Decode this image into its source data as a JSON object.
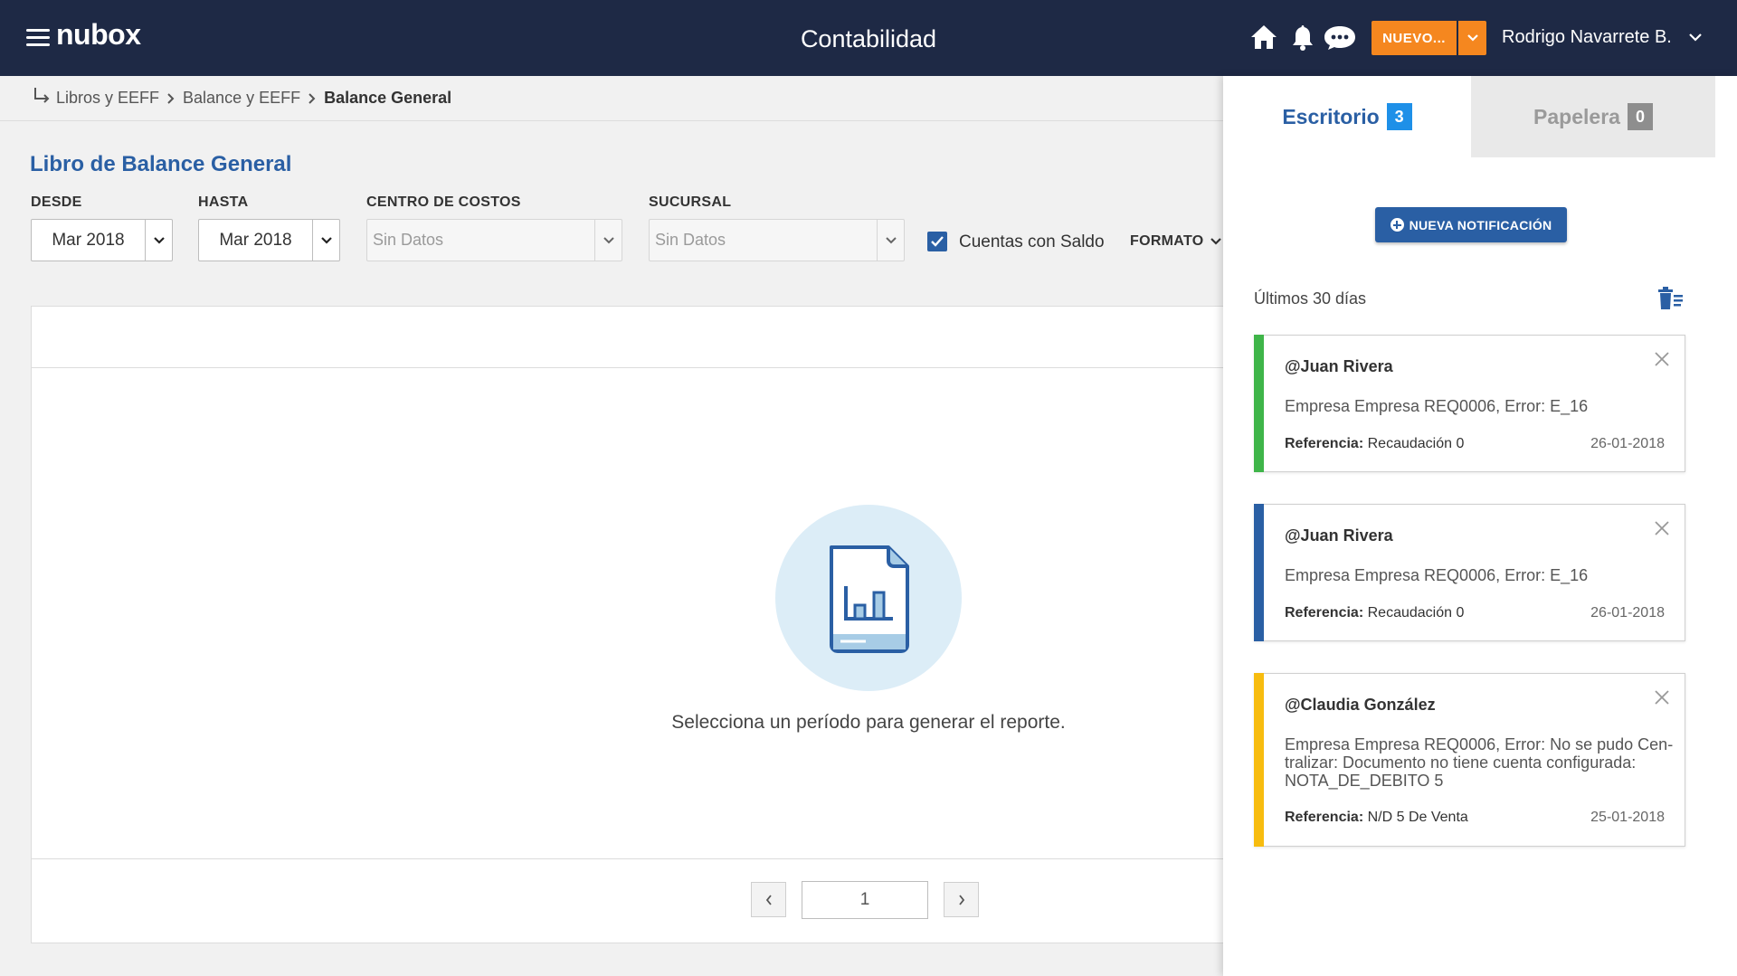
{
  "header": {
    "logo": "nubox",
    "title": "Contabilidad",
    "new_button": "NUEVO...",
    "user_name": "Rodrigo Navarrete B."
  },
  "breadcrumb": [
    "Libros y EEFF",
    "Balance y EEFF",
    "Balance General"
  ],
  "main": {
    "title": "Libro de Balance General",
    "filters": {
      "desde_label": "DESDE",
      "desde_value": "Mar 2018",
      "hasta_label": "HASTA",
      "hasta_value": "Mar 2018",
      "centro_label": "CENTRO DE COSTOS",
      "centro_value": "Sin Datos",
      "sucursal_label": "SUCURSAL",
      "sucursal_value": "Sin Datos",
      "checkbox_label": "Cuentas con Saldo",
      "checkbox_checked": true,
      "formato_label": "FORMATO"
    },
    "empty_message": "Selecciona un período para generar el reporte.",
    "pagination": {
      "page": "1"
    }
  },
  "panel": {
    "tabs": [
      {
        "label": "Escritorio",
        "count": "3"
      },
      {
        "label": "Papelera",
        "count": "0"
      }
    ],
    "new_notification": "NUEVA NOTIFICACIÓN",
    "period": "Últimos 30 días",
    "notifications": [
      {
        "author": "@Juan Rivera",
        "message": "Empresa Empresa REQ0006, Error: E_16",
        "ref_label": "Referencia:",
        "ref_value": "Recaudación 0",
        "date": "26-01-2018",
        "color": "#3fb549"
      },
      {
        "author": "@Juan Rivera",
        "message": "Empresa Empresa REQ0006, Error: E_16",
        "ref_label": "Referencia:",
        "ref_value": "Recaudación 0",
        "date": "26-01-2018",
        "color": "#2a5fa4"
      },
      {
        "author": "@Claudia González",
        "message": "Empresa Empresa REQ0006, Error: No se pudo Cen-tralizar: Documento no tiene cuenta configurada: NOTA_DE_DEBITO 5",
        "ref_label": "Referencia:",
        "ref_value": "N/D 5 De Venta",
        "date": "25-01-2018",
        "color": "#f7bc0f"
      }
    ]
  },
  "colors": {
    "topbar": "#1e2945",
    "accent_orange": "#f5871f",
    "primary_blue": "#2a5fa4",
    "badge_blue": "#1e90e8"
  },
  "icons": [
    "menu-icon",
    "home-icon",
    "bell-icon",
    "chat-icon",
    "chevron-down-icon",
    "return-arrow-icon",
    "chevron-right-icon",
    "checkmark-icon",
    "report-document-icon",
    "chevron-left-icon",
    "plus-circle-icon",
    "trash-list-icon",
    "close-icon"
  ]
}
